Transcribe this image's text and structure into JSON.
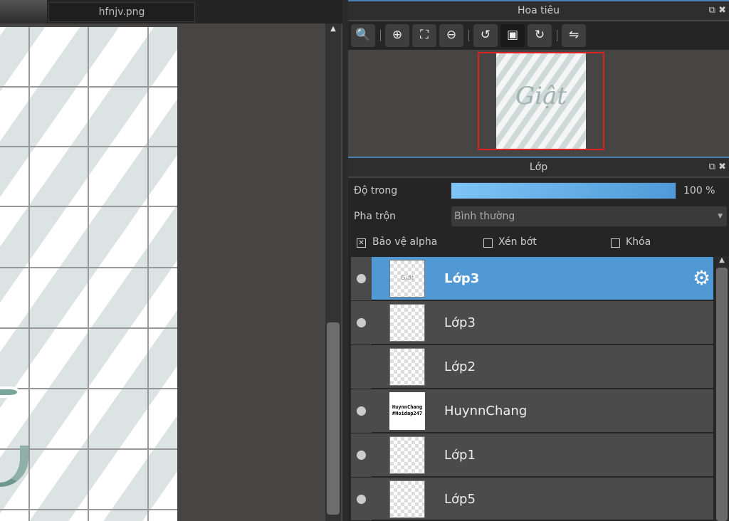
{
  "document_tab": {
    "label": "hfnjv.png"
  },
  "navigator": {
    "title": "Hoa tiêu",
    "preview_text": "Giật",
    "toolbar": [
      {
        "name": "zoom-actual-size",
        "icon": "🔍"
      },
      {
        "name": "zoom-in",
        "icon": "⊕"
      },
      {
        "name": "fit-to-window",
        "icon": "⛶"
      },
      {
        "name": "zoom-out",
        "icon": "⊖"
      },
      {
        "name": "rotate-left",
        "icon": "↺"
      },
      {
        "name": "fit-canvas",
        "icon": "▣"
      },
      {
        "name": "rotate-right",
        "icon": "↻"
      },
      {
        "name": "flip-horizontal",
        "icon": "⇋"
      }
    ]
  },
  "layers_panel": {
    "title": "Lớp",
    "opacity_label": "Độ trong",
    "opacity_value": "100 %",
    "opacity_fraction": 1.0,
    "blend_label": "Pha trộn",
    "blend_value": "Bình thường",
    "protect_alpha": {
      "label": "Bảo vệ alpha",
      "checked": true
    },
    "clipping": {
      "label": "Xén bớt",
      "checked": false
    },
    "lock": {
      "label": "Khóa",
      "checked": false
    },
    "layers": [
      {
        "name": "Lớp3",
        "visible": true,
        "selected": true,
        "thumb": "Giật"
      },
      {
        "name": "Lớp3",
        "visible": true,
        "selected": false,
        "thumb": ""
      },
      {
        "name": "Lớp2",
        "visible": false,
        "selected": false,
        "thumb": ""
      },
      {
        "name": "HuynnChang",
        "visible": true,
        "selected": false,
        "thumb": "HuynnChang #Hoidap247"
      },
      {
        "name": "Lớp1",
        "visible": true,
        "selected": false,
        "thumb": ""
      },
      {
        "name": "Lớp5",
        "visible": true,
        "selected": false,
        "thumb": ""
      }
    ]
  },
  "colors": {
    "accent": "#5199d4",
    "navigator_frame": "#e02020",
    "panel_bg": "#474544"
  }
}
